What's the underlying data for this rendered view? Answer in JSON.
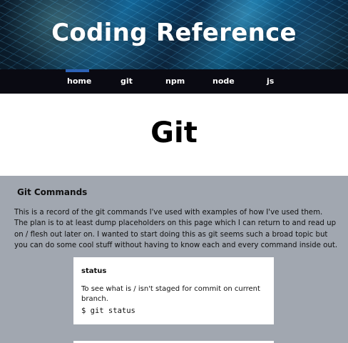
{
  "hero": {
    "title": "Coding Reference"
  },
  "nav": {
    "items": [
      "home",
      "git",
      "npm",
      "node",
      "js"
    ],
    "active": "home"
  },
  "page": {
    "heading": "Git"
  },
  "content": {
    "section_title": "Git Commands",
    "intro": "This is a record of the git commands I've used with examples of how I've used them. The plan is to at least dump placeholders on this page which I can return to and read up on / flesh out later on. I wanted to start doing this as git seems such a broad topic but you can do some cool stuff without having to know each and every command inside out."
  },
  "cards": [
    {
      "title": "status",
      "description": "To see what is / isn't staged for commit on current branch.",
      "command": "$ git status"
    }
  ],
  "colors": {
    "nav_bg": "#0a0a12",
    "accent": "#2d62b6",
    "content_bg": "#a1a7b0",
    "card_bg": "#ffffff"
  }
}
